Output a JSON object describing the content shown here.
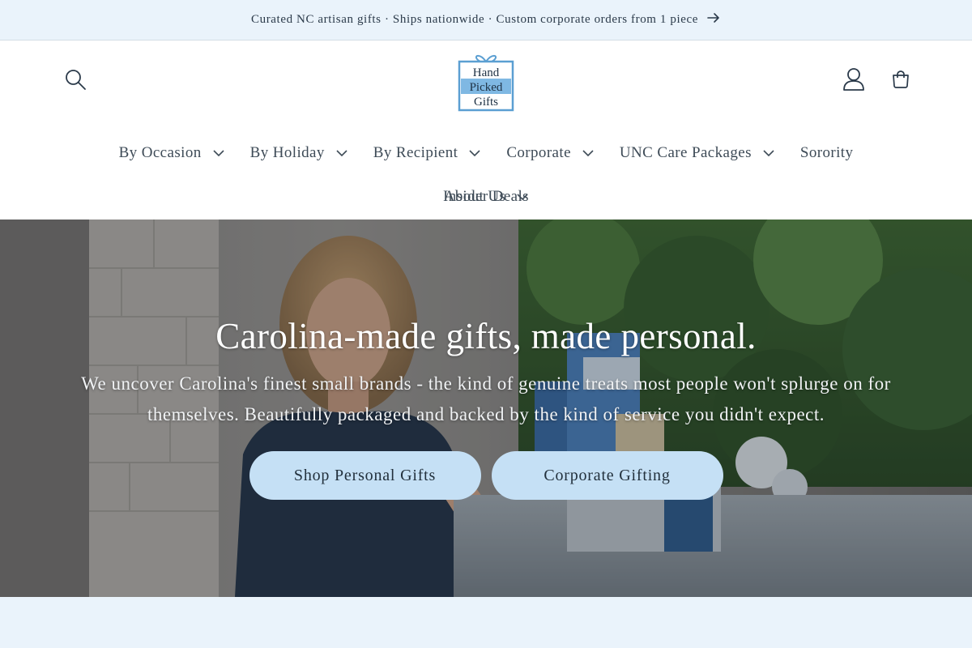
{
  "announcement": {
    "text": "Curated NC artisan gifts · Ships nationwide · Custom corporate orders from 1 piece",
    "icon": "arrow-right-icon"
  },
  "header": {
    "logo": {
      "line1": "Hand",
      "line2": "Picked",
      "line3": "Gifts"
    },
    "icons": {
      "search": "search-icon",
      "account": "user-icon",
      "cart": "cart-icon"
    }
  },
  "nav": {
    "items": [
      {
        "label": "By Occasion",
        "dropdown": true
      },
      {
        "label": "By Holiday",
        "dropdown": true
      },
      {
        "label": "By Recipient",
        "dropdown": true
      },
      {
        "label": "Corporate",
        "dropdown": true
      },
      {
        "label": "UNC Care Packages",
        "dropdown": true
      },
      {
        "label": "Sorority",
        "dropdown": false
      },
      {
        "label": "Insider Deals",
        "dropdown": false
      },
      {
        "label": "About Us",
        "dropdown": true
      }
    ]
  },
  "hero": {
    "title": "Carolina-made gifts, made personal.",
    "subtitle": "We uncover Carolina's finest small brands - the kind of genuine treats most people won't splurge on for themselves. Beautifully packaged and backed by the kind of service you didn't expect.",
    "buttons": {
      "primary": "Shop Personal Gifts",
      "secondary": "Corporate Gifting"
    }
  },
  "colors": {
    "announcement_bg": "#eaf3fb",
    "button_bg": "#c5e0f5",
    "text": "#2b3a4a",
    "logo_blue": "#5b9fd2"
  }
}
